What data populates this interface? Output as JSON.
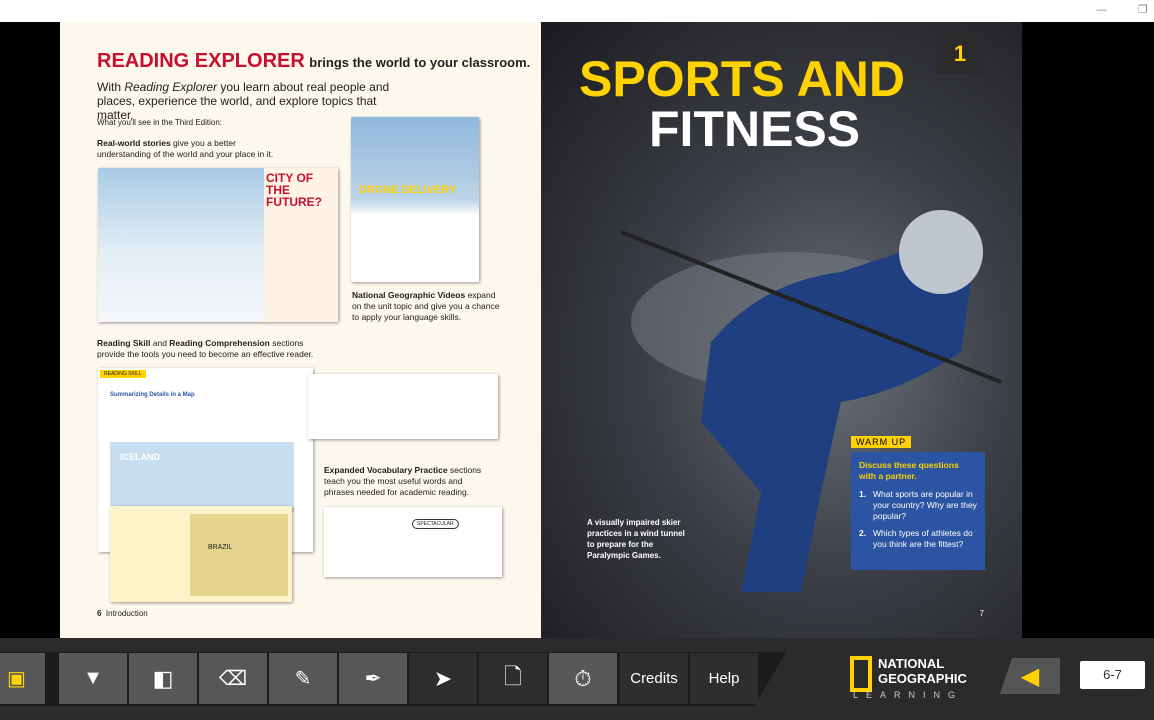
{
  "left_page": {
    "title_brand": "READING EXPLORER",
    "title_rest": "brings the world to your classroom.",
    "intro_pre": "With ",
    "intro_em": "Reading Explorer",
    "intro_post": " you learn about real people and places, experience the world, and explore topics that matter.",
    "see_label": "What you'll see in the Third Edition:",
    "stories_bold": "Real-world stories",
    "stories_rest": " give you a better understanding of the world and your place in it.",
    "city_title": "CITY OF THE FUTURE?",
    "drone_title": "DRONE DELIVERY",
    "videos_bold": "National Geographic Videos",
    "videos_rest": " expand on the unit topic and give you a chance to apply your language skills.",
    "skill_bold1": "Reading Skill",
    "skill_and": " and ",
    "skill_bold2": "Reading Comprehension",
    "skill_rest": " sections provide the tools you need to become an effective reader.",
    "reading_skill_tag": "READING SKILL",
    "skill_heading": "Summarizing Details in a Map",
    "iceland": "ICELAND",
    "brazil": "BRAZIL",
    "vocab_bold": "Expanded Vocabulary Practice",
    "vocab_rest": " sections teach you the most useful words and phrases needed for academic reading.",
    "vocab_word": "SPECTACULAR",
    "page_number": "6",
    "page_label": "Introduction"
  },
  "right_page": {
    "unit_number": "1",
    "title_line1": "SPORTS AND",
    "title_line2": "FITNESS",
    "caption": "A visually impaired skier practices in a wind tunnel to prepare for the Paralympic Games.",
    "warm_up": {
      "label": "WARM UP",
      "prompt": "Discuss these questions with a partner.",
      "questions": [
        {
          "n": "1.",
          "text": "What sports are popular in your country? Why are they popular?"
        },
        {
          "n": "2.",
          "text": "Which types of athletes do you think are the fittest?"
        }
      ]
    },
    "page_number": "7"
  },
  "toolbar": {
    "buttons": [
      "media-icon",
      "presentation-icon",
      "pages-icon",
      "eraser-icon",
      "pencil-icon",
      "pen-icon",
      "pointer-icon",
      "blank-page-icon",
      "timer-icon"
    ],
    "credits": "Credits",
    "help": "Help",
    "logo_line1": "NATIONAL",
    "logo_line2": "GEOGRAPHIC",
    "logo_line3": "LEARNING",
    "page_field": "6-7"
  },
  "colors": {
    "brand_red": "#c8102e",
    "ng_yellow": "#ffd200",
    "warmup_blue": "#2b55a3"
  }
}
